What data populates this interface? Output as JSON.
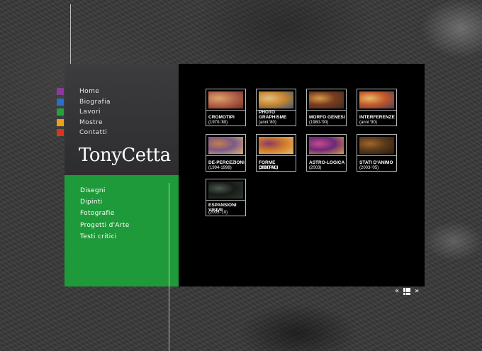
{
  "top_nav": [
    {
      "label": "Home",
      "color": "#8b3a9a"
    },
    {
      "label": "Biografia",
      "color": "#2a6fc9"
    },
    {
      "label": "Lavori",
      "color": "#22a33c"
    },
    {
      "label": "Mostre",
      "color": "#f0a11a"
    },
    {
      "label": "Contatti",
      "color": "#d8351f"
    }
  ],
  "logo": "TonyCetta",
  "sub_nav": [
    "Disegni",
    "Dipinti",
    "Fotografie",
    "Progetti d'Arte",
    "Testi critici"
  ],
  "gallery": [
    {
      "title": "CROMOTIPI",
      "subtitle": "(1970-'80)",
      "colors": [
        "#b8654a",
        "#d9a66b",
        "#6b2f2a"
      ]
    },
    {
      "title": "PHOTO GRAPHISME",
      "subtitle": "(anni '80)",
      "colors": [
        "#c9862f",
        "#e0c080",
        "#3a5a7a"
      ]
    },
    {
      "title": "MORFO GENESI",
      "subtitle": "(1980-'90)",
      "colors": [
        "#7a3d20",
        "#d69a4a",
        "#3d2a22"
      ]
    },
    {
      "title": "INTERFERENZE",
      "subtitle": "(anni '90)",
      "colors": [
        "#c45a2a",
        "#e8b86a",
        "#4b3a5a"
      ]
    },
    {
      "title": "DE-PERCEZIONI",
      "subtitle": "(1994-1998)",
      "colors": [
        "#7a5a88",
        "#c67e4a",
        "#e0b070"
      ]
    },
    {
      "title": "FORME DIGITALI",
      "subtitle": "(2000-'03)",
      "colors": [
        "#d07a2a",
        "#8a3a6a",
        "#e3c06a"
      ]
    },
    {
      "title": "ASTRO-LOGICA",
      "subtitle": "(2003)",
      "colors": [
        "#6a2a7a",
        "#c84a8a",
        "#e09a40"
      ]
    },
    {
      "title": "STATI D'ANIMO",
      "subtitle": "(2003-'05)",
      "colors": [
        "#5a3a1a",
        "#a0662a",
        "#2a1a0a"
      ]
    },
    {
      "title": "ESPANSIONI VISIVE",
      "subtitle": "(2005-'10)",
      "colors": [
        "#1a1a1a",
        "#4a5a4a",
        "#2a3a2a"
      ]
    }
  ],
  "pager": {
    "prev": "«",
    "next": "»"
  }
}
